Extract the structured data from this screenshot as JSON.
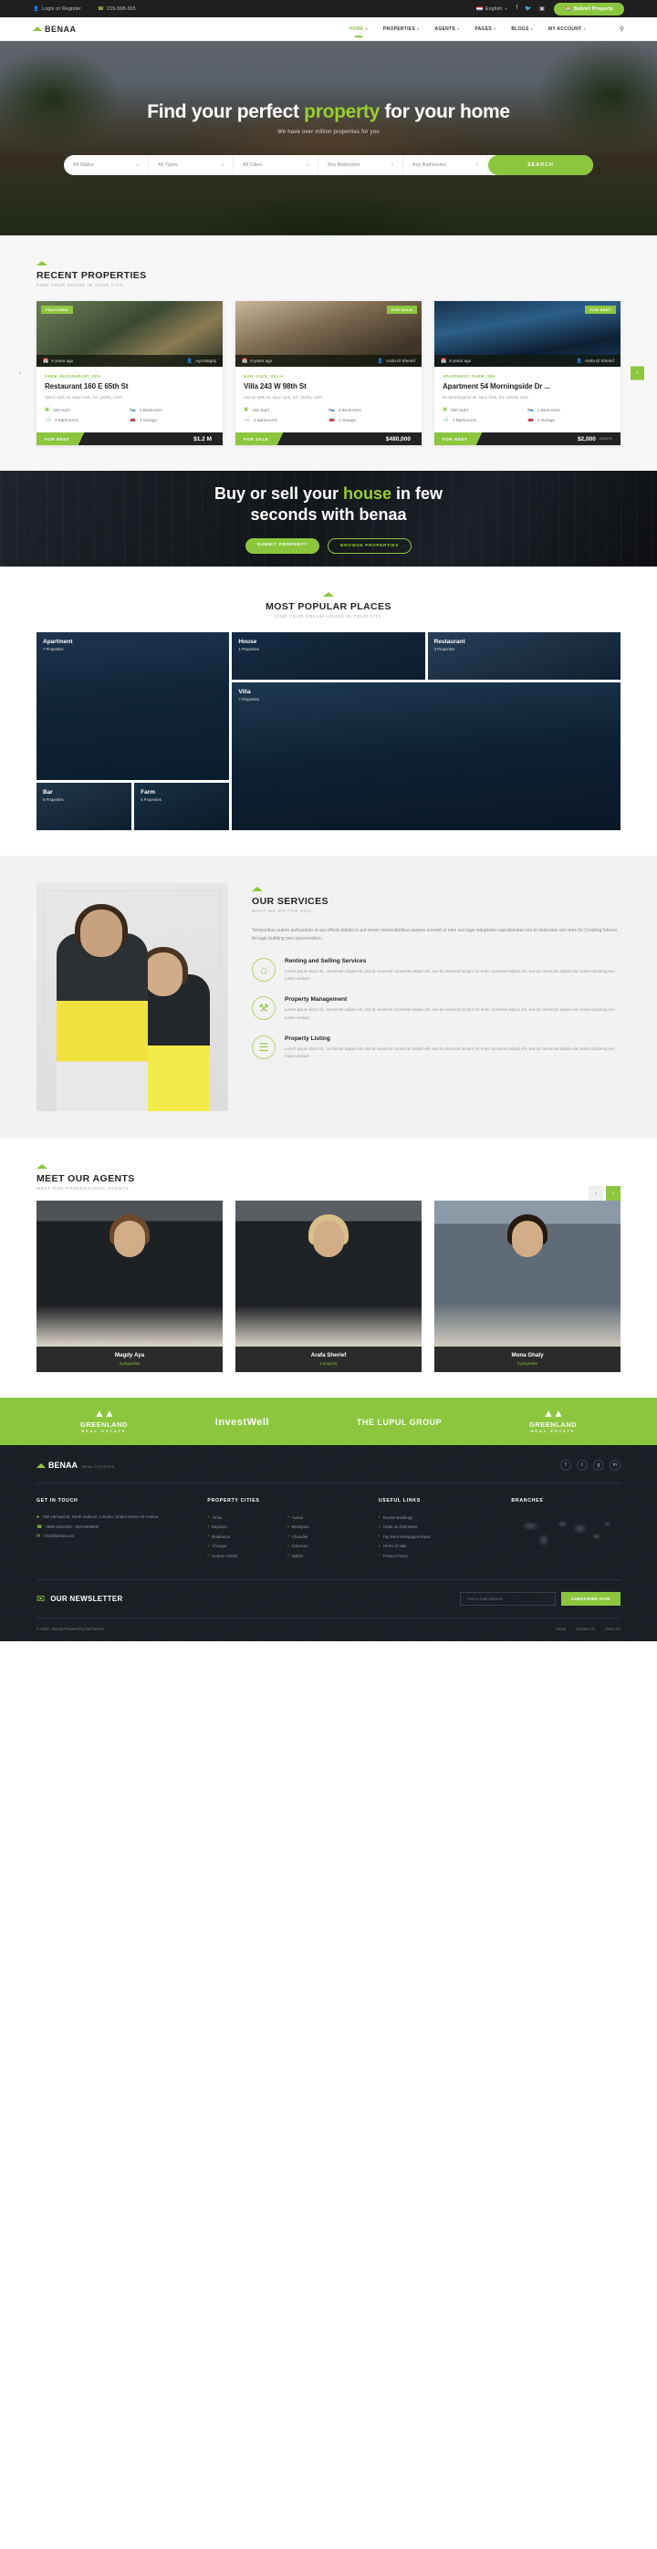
{
  "topbar": {
    "login": "Login or Register",
    "phone": "215-598-365",
    "language": "English",
    "socials": [
      "facebook-icon",
      "twitter-icon",
      "instagram-icon"
    ],
    "submit_label": "Submit Property"
  },
  "nav": {
    "brand": "BENAA",
    "items": [
      {
        "label": "HOME",
        "active": true,
        "caret": true
      },
      {
        "label": "PROPERTIES",
        "active": false,
        "caret": true
      },
      {
        "label": "AGENTS",
        "active": false,
        "caret": true
      },
      {
        "label": "PAGES",
        "active": false,
        "caret": true
      },
      {
        "label": "BLOGS",
        "active": false,
        "caret": true
      },
      {
        "label": "MY ACCOUNT",
        "active": false,
        "caret": true
      }
    ]
  },
  "hero": {
    "title_1": "Find your perfect ",
    "title_hl": "property",
    "title_2": " for your home",
    "subtitle": "We have over million properties for you",
    "search": {
      "status": "All Status",
      "types": "All Types",
      "cities": "All Cities",
      "bedrooms": "Any Bedrooms",
      "bathrooms": "Any Bathrooms",
      "button": "SEARCH"
    }
  },
  "recent": {
    "title": "RECENT PROPERTIES",
    "subtitle": "FIND YOUR HOUSE IN YOUR CITY",
    "cards": [
      {
        "featured": "FEATURED",
        "sale_tag": "",
        "time": "8 years ago",
        "agent": "Aya Magdy",
        "category": "FARM, RESTAURANT, SPA",
        "title": "Restaurant 160 E 65th St",
        "address": "160 E 65th St, New York, NY 10065, USA",
        "sqft": "200 SqFt",
        "bedrooms": "4 Bedrooms",
        "bathrooms": "3 Bathrooms",
        "garage": "1 Garage",
        "status": "FOR RENT",
        "price": "$1.2 M",
        "per": ""
      },
      {
        "featured": "",
        "sale_tag": "FOR SALE",
        "time": "8 years ago",
        "agent": "Arafa El Sherief",
        "category": "BAR, CAFE, VILLA",
        "title": "Villa 243 W 98th St",
        "address": "243 W 98th St, New York, NY 10025, USA",
        "sqft": "230 SqFt",
        "bedrooms": "4 Bedrooms",
        "bathrooms": "4 Bathrooms",
        "garage": "1 Garage",
        "status": "FOR SALE",
        "price": "$480,000",
        "per": ""
      },
      {
        "featured": "",
        "sale_tag": "FOR RENT",
        "time": "8 years ago",
        "agent": "Arafa El Sherief",
        "category": "APARTMENT, FARM, SPA",
        "title": "Apartment 54 Morningside Dr ...",
        "address": "54 Morningside Dr, New York, NY 10025, USA",
        "sqft": "500 SqFt",
        "bedrooms": "2 Bedrooms",
        "bathrooms": "2 Bathrooms",
        "garage": "1 Garage",
        "status": "FOR RENT",
        "price": "$2,000",
        "per": "/ MONTH"
      }
    ]
  },
  "cta": {
    "line1_a": "Buy or sell your ",
    "line1_hl": "house",
    "line1_b": " in few",
    "line2": "seconds with benaa",
    "btn_primary": "SUBMIT PROPERTY",
    "btn_secondary": "BROWSE PROPERTIES"
  },
  "popular": {
    "title": "MOST POPULAR PLACES",
    "subtitle": "FIND YOUR DREAM HOUSE IN YOUR CITY",
    "places": [
      {
        "name": "Apartment",
        "count": "7 Properties"
      },
      {
        "name": "House",
        "count": "1 Properties"
      },
      {
        "name": "Restaurant",
        "count": "3 Properties"
      },
      {
        "name": "Villa",
        "count": "7 Properties"
      },
      {
        "name": "Bar",
        "count": "5 Properties"
      },
      {
        "name": "Farm",
        "count": "5 Properties"
      }
    ]
  },
  "services": {
    "title": "OUR SERVICES",
    "subtitle": "WHAT WE DO FOR YOU",
    "intro": "Temporibus autem quibusdam et aut officiis debitis is aut rerum necessitatibus saepes eveniet ut etes seo lage voluptates repudiandae sint et molestiae non mes for Creating futures through building pres preservation.",
    "items": [
      {
        "icon": "home-icon",
        "title": "Renting and Selling Services",
        "desc": "Lorem ipsum dolor sit , consectet adipisi elit, sed do eiusmod consectet adipisi elit, sed do eiusmod tempor for enim consectet adipisi elit, sed do consectet adipisi elit, sedes doadesg ens minim veniam."
      },
      {
        "icon": "tools-icon",
        "title": "Property Management",
        "desc": "Lorem ipsum dolor sit , consectet adipisi elit, sed do eiusmod consectet adipisi elit, sed do eiusmod tempor for enim consectet adipisi elit, sed do consectet adipisi elit, sedes doadesg ens minim veniam."
      },
      {
        "icon": "list-icon",
        "title": "Property Listing",
        "desc": "Lorem ipsum dolor sit , consectet adipisi elit, sed do eiusmod consectet adipisi elit, sed do eiusmod tempor for enim consectet adipisi elit, sed do consectet adipisi elit, sedes doadesg ens minim veniam."
      }
    ]
  },
  "agents": {
    "title": "MEET OUR AGENTS",
    "subtitle": "MEET OUR PROFESSIONAL AGENTS",
    "list": [
      {
        "name": "Magdy Aya",
        "count": "0 properties"
      },
      {
        "name": "Arafa Sherief",
        "count": "1 property"
      },
      {
        "name": "Mona Ghaly",
        "count": "2 properties"
      }
    ]
  },
  "brands": [
    {
      "name": "GREENLAND",
      "sub": "REAL ESTATE"
    },
    {
      "name": "InvestWell",
      "sub": ""
    },
    {
      "name": "THE LUPUL GROUP",
      "sub": ""
    },
    {
      "name": "GREENLAND",
      "sub": "REAL ESTATE"
    }
  ],
  "footer": {
    "brand": "BENAA",
    "tagline": "REAL ESTATES",
    "socials": [
      "facebook-icon",
      "twitter-icon",
      "google-icon",
      "linkedin-icon"
    ],
    "get_in_touch": {
      "title": "GET IN TOUCH",
      "address": "360 Hemaat St, North Gubrout, London, United States Of Amrica.",
      "phone": "0596-5461050 - 254-6008800",
      "email": "info@benaa.com"
    },
    "property_cities": {
      "title": "PROPERTY CITIES",
      "col1": [
        "Africa",
        "Baytown",
        "Bradenton",
        "Chicago",
        "Corpus Christi"
      ],
      "col2": [
        "Austin",
        "Brampton",
        "Chandler",
        "Coleman",
        "Dallas"
      ]
    },
    "useful_links": {
      "title": "USEFUL LINKS",
      "items": [
        "Rooms Buildings",
        "Order an Estimates",
        "Top Rent Mortgages Rates",
        "Terms of sale",
        "Privacy Policy"
      ]
    },
    "branches": {
      "title": "BRANCHES"
    },
    "newsletter": {
      "title": "OUR NEWSLETTER",
      "placeholder": "Your e-mail address",
      "button": "SUBSCRIBE NOW"
    },
    "copyright": "© 2020 - Benaa Powered by DkThemes",
    "links": [
      "Home",
      "Contact Us",
      "About Us"
    ]
  },
  "colors": {
    "accent": "#8cc63f",
    "dark": "#1f1f1f",
    "bright": "#9acd32"
  }
}
